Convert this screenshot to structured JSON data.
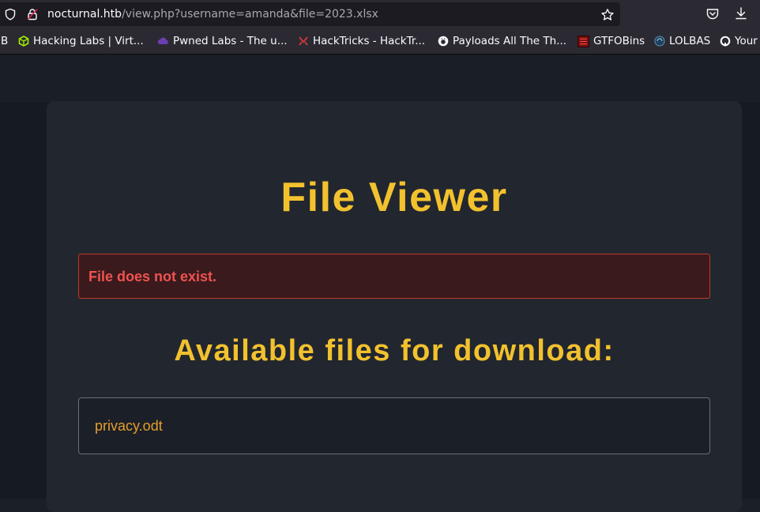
{
  "browser": {
    "url": {
      "host": "nocturnal.htb",
      "path": "/view.php?username=amanda&file=2023.xlsx"
    },
    "bookmarks": [
      {
        "label": "B"
      },
      {
        "label": "Hacking Labs | Virt..."
      },
      {
        "label": "Pwned Labs - The u..."
      },
      {
        "label": "HackTricks - HackTr..."
      },
      {
        "label": "Payloads All The Th..."
      },
      {
        "label": "GTFOBins"
      },
      {
        "label": "LOLBAS"
      },
      {
        "label": "Your"
      }
    ],
    "icons": {
      "tracking": "shield-icon",
      "security": "lock-icon",
      "bookmark": "star-icon",
      "pocket": "pocket-icon",
      "downloads": "download-icon"
    }
  },
  "page": {
    "title": "File Viewer",
    "error": "File does not exist.",
    "files_heading": "Available files for download:",
    "files": [
      {
        "name": "privacy.odt"
      }
    ]
  },
  "colors": {
    "accent": "#f2c12e",
    "error": "#ef5350",
    "link": "#e59e2c",
    "card": "#22262e",
    "background": "#1b1f27"
  }
}
